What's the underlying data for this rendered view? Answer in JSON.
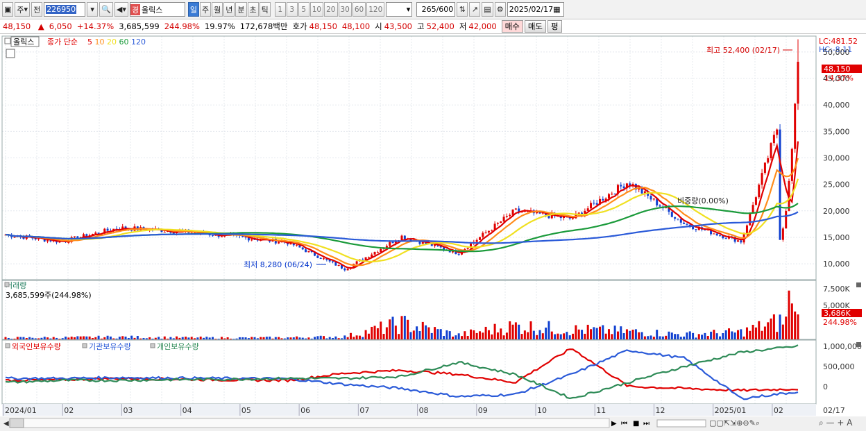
{
  "toolbar": {
    "period_selector": "주",
    "compare_label": "전",
    "code": "226950",
    "stock_tag": "경",
    "stock_name": "올릭스",
    "period_tabs": [
      "일",
      "주",
      "월",
      "년",
      "분",
      "초",
      "틱"
    ],
    "active_tab": "일",
    "interval_buttons": [
      "1",
      "3",
      "5",
      "10",
      "20",
      "30",
      "60",
      "120"
    ],
    "count": "265",
    "count_total": "/600",
    "date": "2025/02/17"
  },
  "quote": {
    "price": "48,150",
    "change": "6,050",
    "change_pct": "+14.37%",
    "volume": "3,685,599",
    "volume_ratio": "244.98%",
    "turnover": "19.97%",
    "amount": "172,678백만",
    "bid_label": "호가",
    "ask": "48,150",
    "bid": "48,100",
    "open_label": "시",
    "open": "43,500",
    "high_label": "고",
    "high": "52,400",
    "low_label": "저",
    "low": "42,000",
    "buy_button": "매수",
    "sell_button": "매도",
    "eval_button": "평"
  },
  "price_panel": {
    "name_tag": "올릭스",
    "legend_label": "종가 단순",
    "ma_periods": [
      "5",
      "10",
      "20",
      "60",
      "120"
    ],
    "ma_colors": [
      "#e00000",
      "#ff8c1a",
      "#f0e020",
      "#1a9a3a",
      "#2a5ad8"
    ],
    "lc_label": "LC:481.52",
    "hc_label": "HC:-8.11",
    "max_annotation": "최고 52,400 (02/17)",
    "min_annotation": "최저 8,280 (06/24)",
    "current_price_tag": "48,150",
    "current_pct_tag": "14.37%",
    "ratio_label": "비중량(0.00%)",
    "y_ticks": [
      "50,000",
      "45,000",
      "40,000",
      "35,000",
      "30,000",
      "25,000",
      "20,000",
      "15,000",
      "10,000"
    ]
  },
  "volume_panel": {
    "title": "거래량",
    "value_label": "3,685,599주(244.98%)",
    "y_ticks": [
      "7,500K",
      "5,000K"
    ],
    "current_tag": "3,686K",
    "pct_tag": "244.98%"
  },
  "holding_panel": {
    "legends": [
      "외국인보유수량",
      "기관보유수량",
      "개인보유수량"
    ],
    "legend_colors": [
      "#e00000",
      "#2a5ad8",
      "#2e8b57"
    ],
    "y_ticks": [
      "1,000,000",
      "500,000",
      "0"
    ]
  },
  "x_axis": {
    "labels": [
      "2024/01",
      "02",
      "03",
      "04",
      "05",
      "06",
      "07",
      "08",
      "09",
      "10",
      "11",
      "12",
      "2025/01",
      "02"
    ],
    "end_label": "02/17"
  },
  "chart_data": [
    {
      "type": "candlestick",
      "title": "올릭스",
      "x": [
        "2024/01",
        "02",
        "03",
        "04",
        "05",
        "06",
        "07",
        "08",
        "09",
        "10",
        "11",
        "12",
        "2025/01",
        "02",
        "02/17"
      ],
      "close_approx": [
        15500,
        14200,
        16800,
        16200,
        15200,
        14000,
        9000,
        15200,
        12000,
        20000,
        18500,
        25500,
        17500,
        14200,
        48150
      ],
      "moving_averages": [
        "5",
        "10",
        "20",
        "60",
        "120"
      ],
      "ylim": [
        7000,
        53000
      ],
      "max": {
        "value": 52400,
        "date": "02/17"
      },
      "min": {
        "value": 8280,
        "date": "06/24"
      }
    },
    {
      "type": "bar",
      "title": "거래량",
      "x": [
        "2024/01",
        "02",
        "03",
        "04",
        "05",
        "06",
        "07",
        "08",
        "09",
        "10",
        "11",
        "12",
        "2025/01",
        "02",
        "02/17"
      ],
      "values_k_approx": [
        250,
        300,
        400,
        300,
        250,
        300,
        450,
        2600,
        700,
        2200,
        1600,
        1300,
        800,
        1200,
        3686
      ],
      "ylim": [
        0,
        8500
      ]
    },
    {
      "type": "line",
      "x": [
        "2024/01",
        "02",
        "03",
        "04",
        "05",
        "06",
        "07",
        "08",
        "09",
        "10",
        "11",
        "12",
        "2025/01",
        "02",
        "02/17"
      ],
      "series": [
        {
          "name": "외국인보유수량",
          "values": [
            150000,
            170000,
            200000,
            180000,
            160000,
            150000,
            330000,
            400000,
            300000,
            100000,
            950000,
            0,
            -50000,
            -100000,
            -60000
          ]
        },
        {
          "name": "기관보유수량",
          "values": [
            200000,
            200000,
            220000,
            210000,
            200000,
            190000,
            50000,
            -50000,
            -250000,
            -200000,
            300000,
            900000,
            700000,
            -300000,
            -130000
          ]
        },
        {
          "name": "개인보유수량",
          "values": [
            100000,
            150000,
            150000,
            170000,
            180000,
            200000,
            200000,
            250000,
            600000,
            300000,
            -300000,
            100000,
            500000,
            850000,
            1000000
          ]
        }
      ],
      "ylim": [
        -400000,
        1100000
      ]
    }
  ]
}
